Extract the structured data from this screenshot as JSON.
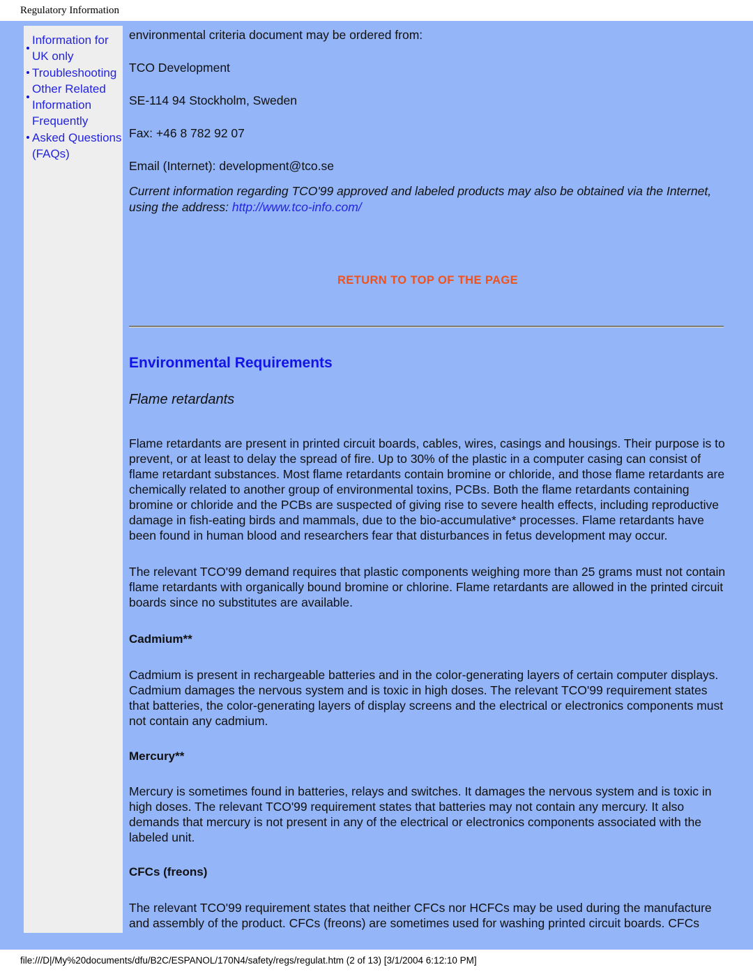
{
  "print_header": {
    "title": "Regulatory Information"
  },
  "sidebar": {
    "items": [
      {
        "label": "Information for UK only"
      },
      {
        "label": "Troubleshooting"
      },
      {
        "label": "Other Related Information"
      },
      {
        "label": "Frequently Asked Questions (FAQs)"
      }
    ]
  },
  "content": {
    "intro_line": "environmental criteria document may be ordered from:",
    "address": [
      "TCO Development",
      "SE-114 94 Stockholm, Sweden",
      "Fax: +46 8 782 92 07",
      "Email (Internet): development@tco.se"
    ],
    "italic_note": "Current information regarding TCO'99 approved and labeled products may also be obtained via the Internet, using the address: ",
    "italic_note_link": "http://www.tco-info.com/",
    "return_to_top": "RETURN TO TOP OF THE PAGE",
    "section_title": "Environmental Requirements",
    "subsection_title": "Flame retardants",
    "flame_para_1": "Flame retardants are present in printed circuit boards, cables, wires, casings and housings. Their purpose is to prevent, or at least to delay the spread of fire. Up to 30% of the plastic in a computer casing can consist of flame retardant substances. Most flame retardants contain bromine or chloride, and those flame retardants are chemically related to another group of environmental toxins, PCBs. Both the flame retardants containing bromine or chloride and the PCBs are suspected of giving rise to severe health effects, including reproductive damage in fish-eating birds and mammals, due to the bio-accumulative* processes. Flame retardants have been found in human blood and researchers fear that disturbances in fetus development may occur.",
    "flame_para_2": "The relevant TCO'99 demand requires that plastic components weighing more than 25 grams must not contain flame retardants with organically bound bromine or chlorine. Flame retardants are allowed in the printed circuit boards since no substitutes are available.",
    "cadmium_heading": "Cadmium**",
    "cadmium_para": "Cadmium is present in rechargeable batteries and in the color-generating layers of certain computer displays. Cadmium damages the nervous system and is toxic in high doses. The relevant TCO'99 requirement states that batteries, the color-generating layers of display screens and the electrical or electronics components must not contain any cadmium.",
    "mercury_heading": "Mercury**",
    "mercury_para": "Mercury is sometimes found in batteries, relays and switches. It damages the nervous system and is toxic in high doses. The relevant TCO'99 requirement states that batteries may not contain any mercury. It also demands that mercury is not present in any of the electrical or electronics components associated with the labeled unit.",
    "cfcs_heading": "CFCs (freons)",
    "cfcs_para": "The relevant TCO'99 requirement states that neither CFCs nor HCFCs may be used during the manufacture and assembly of the product. CFCs (freons) are sometimes used for washing printed circuit boards. CFCs"
  },
  "print_footer": {
    "text": "file:///D|/My%20documents/dfu/B2C/ESPANOL/170N4/safety/regs/regulat.htm (2 of 13) [3/1/2004 6:12:10 PM]"
  },
  "colors": {
    "page_background": "#94b5f8",
    "sidebar_background": "#eeeeee",
    "link": "#2323e0",
    "accent_heading": "#1414e6",
    "return_top": "#f1511b",
    "text": "#111111"
  }
}
